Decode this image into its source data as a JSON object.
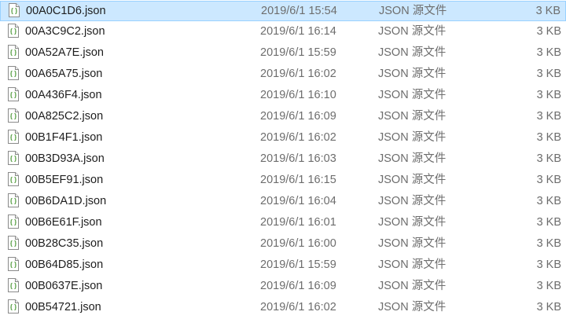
{
  "files": [
    {
      "name": "00A0C1D6.json",
      "modified": "2019/6/1 15:54",
      "type": "JSON 源文件",
      "size": "3 KB",
      "selected": true
    },
    {
      "name": "00A3C9C2.json",
      "modified": "2019/6/1 16:14",
      "type": "JSON 源文件",
      "size": "3 KB"
    },
    {
      "name": "00A52A7E.json",
      "modified": "2019/6/1 15:59",
      "type": "JSON 源文件",
      "size": "3 KB"
    },
    {
      "name": "00A65A75.json",
      "modified": "2019/6/1 16:02",
      "type": "JSON 源文件",
      "size": "3 KB"
    },
    {
      "name": "00A436F4.json",
      "modified": "2019/6/1 16:10",
      "type": "JSON 源文件",
      "size": "3 KB"
    },
    {
      "name": "00A825C2.json",
      "modified": "2019/6/1 16:09",
      "type": "JSON 源文件",
      "size": "3 KB"
    },
    {
      "name": "00B1F4F1.json",
      "modified": "2019/6/1 16:02",
      "type": "JSON 源文件",
      "size": "3 KB"
    },
    {
      "name": "00B3D93A.json",
      "modified": "2019/6/1 16:03",
      "type": "JSON 源文件",
      "size": "3 KB"
    },
    {
      "name": "00B5EF91.json",
      "modified": "2019/6/1 16:15",
      "type": "JSON 源文件",
      "size": "3 KB"
    },
    {
      "name": "00B6DA1D.json",
      "modified": "2019/6/1 16:04",
      "type": "JSON 源文件",
      "size": "3 KB"
    },
    {
      "name": "00B6E61F.json",
      "modified": "2019/6/1 16:01",
      "type": "JSON 源文件",
      "size": "3 KB"
    },
    {
      "name": "00B28C35.json",
      "modified": "2019/6/1 16:00",
      "type": "JSON 源文件",
      "size": "3 KB"
    },
    {
      "name": "00B64D85.json",
      "modified": "2019/6/1 15:59",
      "type": "JSON 源文件",
      "size": "3 KB"
    },
    {
      "name": "00B0637E.json",
      "modified": "2019/6/1 16:09",
      "type": "JSON 源文件",
      "size": "3 KB"
    },
    {
      "name": "00B54721.json",
      "modified": "2019/6/1 16:02",
      "type": "JSON 源文件",
      "size": "3 KB"
    }
  ],
  "icon": "json-file-icon",
  "colors": {
    "selection_bg": "#cce8ff",
    "selection_border": "#99d1ff",
    "secondary_text": "#6d6d6d"
  }
}
